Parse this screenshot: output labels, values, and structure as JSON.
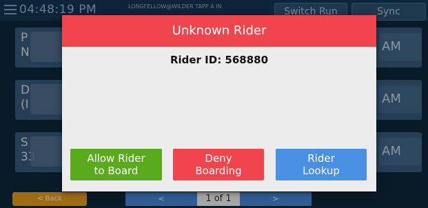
{
  "topbar": {
    "time": "04:48:19 PM",
    "route": "LONGFELLOW@WILDER TAPP A IN",
    "switch_run_label": "Switch Run",
    "sync_label": "Sync"
  },
  "rows": [
    {
      "name": "P\nN",
      "time": "AM"
    },
    {
      "name": "D\n(I",
      "time": "AM"
    },
    {
      "name": "S\n33",
      "time": "AM"
    }
  ],
  "dialog": {
    "title": "Unknown Rider",
    "rider_id": "Rider ID: 568880",
    "buttons": {
      "allow": "Allow Rider\nto Board",
      "deny": "Deny\nBoarding",
      "lookup": "Rider\nLookup"
    }
  },
  "pagination": {
    "back_label": "< Back",
    "prev_label": "<",
    "page": "1 of 1",
    "next_label": ">"
  },
  "colors": {
    "header_red": "#f0454d",
    "allow_green": "#5aaa1e",
    "lookup_blue": "#4a90e2",
    "back_orange": "#f5a623",
    "row_blue": "#3b6186"
  },
  "icons": {
    "menu": "hamburger-menu-icon"
  }
}
